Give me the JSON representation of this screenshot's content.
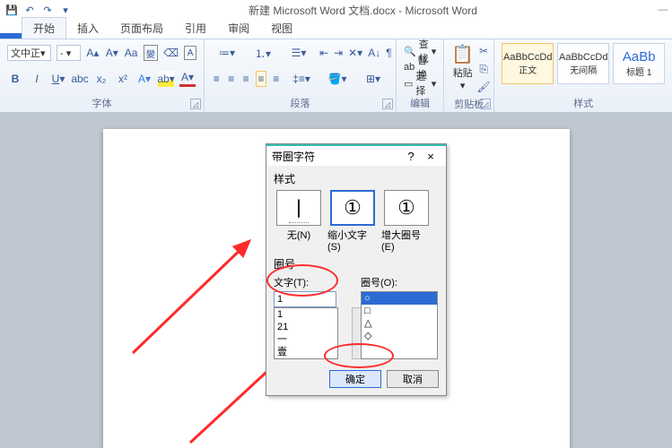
{
  "titlebar": {
    "title": "新建 Microsoft Word 文档.docx - Microsoft Word"
  },
  "tabs": {
    "file": "",
    "home": "开始",
    "insert": "插入",
    "layout": "页面布局",
    "references": "引用",
    "review": "审阅",
    "view": "视图"
  },
  "ribbon": {
    "font_name": "文中正",
    "font_group": "字体",
    "para_group": "段落",
    "edit_group": "编辑",
    "clip_group": "剪贴板",
    "style_group": "样式",
    "find": "查找",
    "replace": "替换",
    "select": "选择",
    "paste": "粘贴",
    "style1_sample": "AaBbCcDd",
    "style1_name": "正文",
    "style2_sample": "AaBbCcDd",
    "style2_name": "无间隔",
    "style3_sample": "AaBb",
    "style3_name": "标题 1"
  },
  "dialog": {
    "title": "带圈字符",
    "style_label": "样式",
    "opt_none": "无(N)",
    "opt_shrink": "缩小文字(S)",
    "opt_enlarge": "增大圈号(E)",
    "num_label": "圈号",
    "text_label": "文字(T):",
    "ring_label": "圈号(O):",
    "text_value": "1",
    "text_options": [
      "1",
      "21",
      "一",
      "壹"
    ],
    "ring_options": [
      "○",
      "□",
      "△",
      "◇"
    ],
    "ok": "确定",
    "cancel": "取消"
  }
}
